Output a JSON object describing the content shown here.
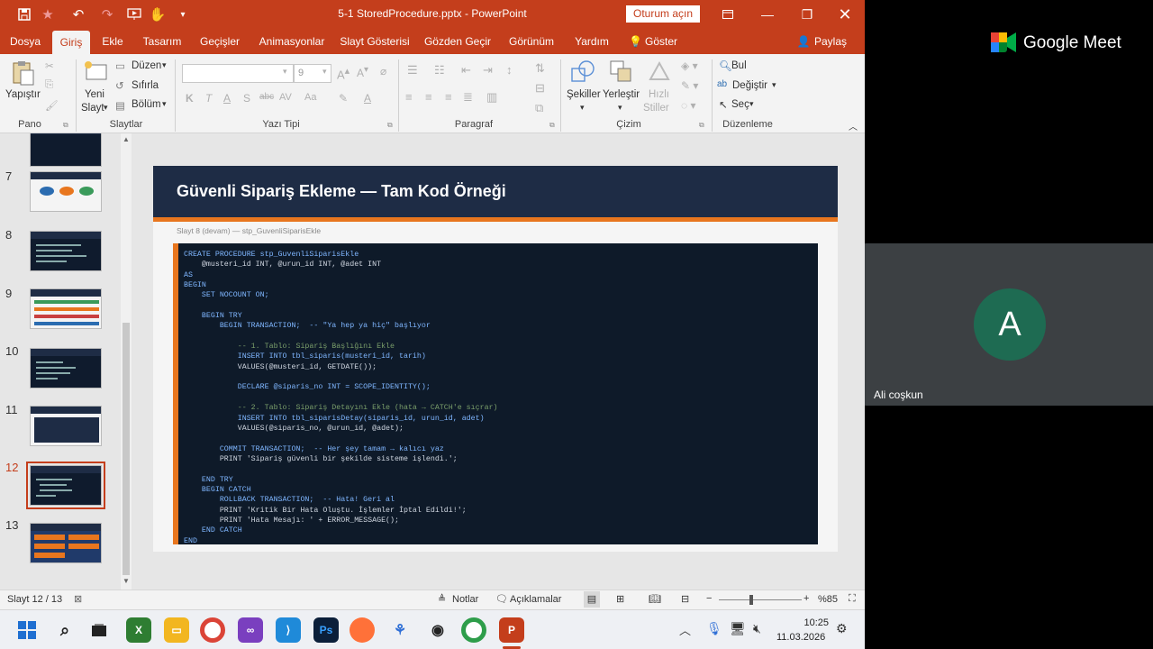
{
  "titlebar": {
    "document_title": "5-1 StoredProcedure.pptx - PowerPoint",
    "signin_label": "Oturum açın"
  },
  "tabs": [
    "Dosya",
    "Giriş",
    "Ekle",
    "Tasarım",
    "Geçişler",
    "Animasyonlar",
    "Slayt Gösterisi",
    "Gözden Geçir",
    "Görünüm",
    "Yardım",
    "Göster"
  ],
  "share_label": "Paylaş",
  "ribbon": {
    "paste_label": "Yapıştır",
    "clipboard_group": "Pano",
    "new_slide_line1": "Yeni",
    "new_slide_line2": "Slayt",
    "layout_label": "Düzen",
    "reset_label": "Sıfırla",
    "section_label": "Bölüm",
    "slides_group": "Slaytlar",
    "font_size": "9",
    "font_group": "Yazı Tipi",
    "paragraph_group": "Paragraf",
    "shapes_label": "Şekiller",
    "arrange_label": "Yerleştir",
    "quick_styles_line1": "Hızlı",
    "quick_styles_line2": "Stiller",
    "drawing_group": "Çizim",
    "find_label": "Bul",
    "replace_label": "Değiştir",
    "select_label": "Seç",
    "editing_group": "Düzenleme"
  },
  "thumbnails": {
    "numbers": [
      "7",
      "8",
      "9",
      "10",
      "11",
      "12",
      "13"
    ],
    "selected": "12"
  },
  "slide": {
    "title": "Güvenli Sipariş Ekleme — Tam Kod Örneği",
    "subtitle": "Slayt 8 (devam) — stp_GuvenliSiparisEkle",
    "code": [
      "CREATE PROCEDURE stp_GuvenliSiparisEkle",
      "    @musteri_id INT, @urun_id INT, @adet INT",
      "AS",
      "BEGIN",
      "    SET NOCOUNT ON;",
      "",
      "    BEGIN TRY",
      "        BEGIN TRANSACTION;  -- \"Ya hep ya hiç\" başlıyor",
      "",
      "            -- 1. Tablo: Sipariş Başlığını Ekle",
      "            INSERT INTO tbl_siparis(musteri_id, tarih)",
      "            VALUES(@musteri_id, GETDATE());",
      "",
      "            DECLARE @siparis_no INT = SCOPE_IDENTITY();",
      "",
      "            -- 2. Tablo: Sipariş Detayını Ekle (hata → CATCH'e sıçrar)",
      "            INSERT INTO tbl_siparisDetay(siparis_id, urun_id, adet)",
      "            VALUES(@siparis_no, @urun_id, @adet);",
      "",
      "        COMMIT TRANSACTION;  -- Her şey tamam → kalıcı yaz",
      "        PRINT 'Sipariş güvenli bir şekilde sisteme işlendi.';",
      "",
      "    END TRY",
      "    BEGIN CATCH",
      "        ROLLBACK TRANSACTION;  -- Hata! Geri al",
      "        PRINT 'Kritik Bir Hata Oluştu. İşlemler İptal Edildi!';",
      "        PRINT 'Hata Mesajı: ' + ERROR_MESSAGE();",
      "    END CATCH",
      "END"
    ]
  },
  "statusbar": {
    "slide_counter": "Slayt 12 / 13",
    "notes_label": "Notlar",
    "comments_label": "Açıklamalar",
    "zoom_label": "%85"
  },
  "taskbar": {
    "time": "10:25",
    "date": "11.03.2026"
  },
  "meet": {
    "brand": "Google Meet",
    "avatar_letter": "A",
    "participant_name": "Ali coşkun"
  },
  "colors": {
    "ppt_accent": "#c43e1c",
    "slide_header": "#1e2c45",
    "slide_accent": "#e8761e",
    "avatar": "#1e6b52"
  }
}
